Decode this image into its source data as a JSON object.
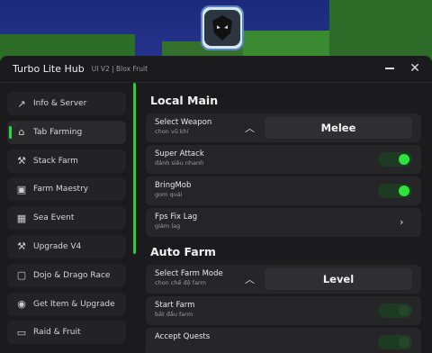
{
  "window": {
    "title": "Turbo Lite Hub",
    "subtitle": "UI V2 | Blox Fruit"
  },
  "sidebar": {
    "items": [
      {
        "label": "Info & Server",
        "icon": "chart-line-icon",
        "glyph": "↗",
        "active": false
      },
      {
        "label": "Tab Farming",
        "icon": "home-icon",
        "glyph": "⌂",
        "active": true
      },
      {
        "label": "Stack Farm",
        "icon": "hammer-icon",
        "glyph": "⚒",
        "active": false
      },
      {
        "label": "Farm Maestry",
        "icon": "box-icon",
        "glyph": "▣",
        "active": false
      },
      {
        "label": "Sea Event",
        "icon": "calendar-icon",
        "glyph": "▦",
        "active": false
      },
      {
        "label": "Upgrade V4",
        "icon": "pickaxe-icon",
        "glyph": "⚒",
        "active": false
      },
      {
        "label": "Dojo & Drago Race",
        "icon": "bag-icon",
        "glyph": "▢",
        "active": false
      },
      {
        "label": "Get Item & Upgrade",
        "icon": "robot-icon",
        "glyph": "◉",
        "active": false
      },
      {
        "label": "Raid & Fruit",
        "icon": "car-icon",
        "glyph": "▭",
        "active": false
      }
    ]
  },
  "main": {
    "section1": {
      "title": "Local Main",
      "select_weapon": {
        "label": "Select Weapon",
        "desc": "chon vũ khí",
        "value": "Melee"
      },
      "super_attack": {
        "label": "Super Attack",
        "desc": "đánh siêu nhanh",
        "on": true
      },
      "bring_mob": {
        "label": "BringMob",
        "desc": "gom quái",
        "on": true
      },
      "fps_fix": {
        "label": "Fps Fix Lag",
        "desc": "giảm lag"
      }
    },
    "section2": {
      "title": "Auto Farm",
      "select_mode": {
        "label": "Select Farm Mode",
        "desc": "chon chế độ farm",
        "value": "Level"
      },
      "start_farm": {
        "label": "Start Farm",
        "desc": "bắt đầu farm",
        "on": false
      },
      "accept_quests": {
        "label": "Accept Quests"
      }
    }
  },
  "colors": {
    "accent": "#2fe33f",
    "panel": "#1b1b1d"
  }
}
